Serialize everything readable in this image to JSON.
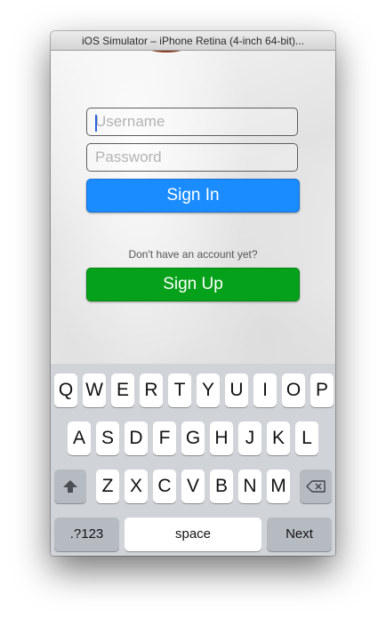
{
  "window": {
    "title": "iOS Simulator – iPhone Retina (4-inch 64-bit)..."
  },
  "login": {
    "username_placeholder": "Username",
    "password_placeholder": "Password",
    "signin_label": "Sign In",
    "no_account_text": "Don't have an account yet?",
    "signup_label": "Sign Up"
  },
  "colors": {
    "signin": "#1a8cff",
    "signup": "#06a11a",
    "caret": "#2a62e0"
  },
  "keyboard": {
    "row1": [
      "Q",
      "W",
      "E",
      "R",
      "T",
      "Y",
      "U",
      "I",
      "O",
      "P"
    ],
    "row2": [
      "A",
      "S",
      "D",
      "F",
      "G",
      "H",
      "J",
      "K",
      "L"
    ],
    "row3": [
      "Z",
      "X",
      "C",
      "V",
      "B",
      "N",
      "M"
    ],
    "shift_icon": "shift-arrow-icon",
    "delete_icon": "backspace-icon",
    "numbers_label": ".?123",
    "space_label": "space",
    "next_label": "Next"
  }
}
